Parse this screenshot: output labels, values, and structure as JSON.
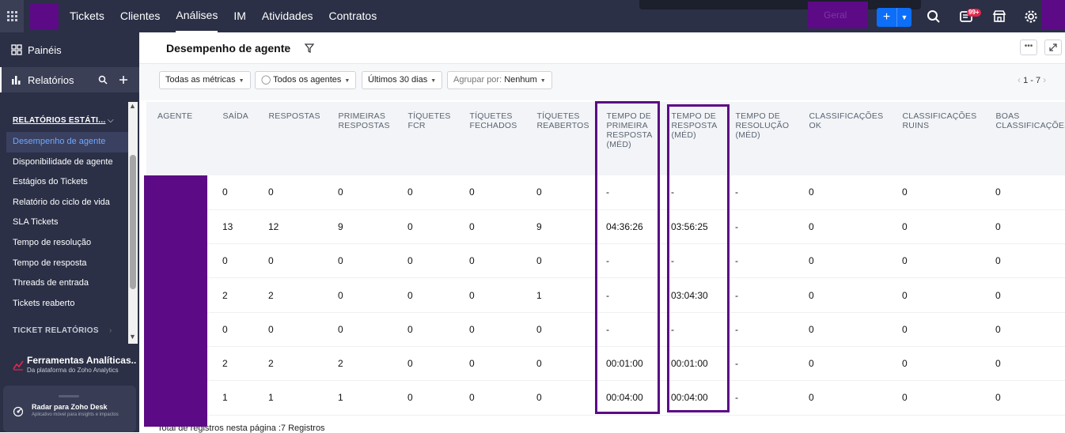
{
  "topbar": {
    "nav": [
      "Tickets",
      "Clientes",
      "Análises",
      "IM",
      "Atividades",
      "Contratos"
    ],
    "active_nav": "Análises",
    "department_label": "Geral",
    "add_label": "+",
    "notification_badge": "99+",
    "colors": {
      "bar": "#2b3046",
      "accent": "#0d6ef7",
      "redaction": "#5c0a85"
    }
  },
  "sidebar": {
    "dashboards_label": "Painéis",
    "reports_label": "Relatórios",
    "section_label": "RELATÓRIOS ESTÁTI...",
    "items": [
      "Desempenho de agente",
      "Disponibilidade de agente",
      "Estágios do Tickets",
      "Relatório do ciclo de vida",
      "SLA Tickets",
      "Tempo de resolução",
      "Tempo de resposta",
      "Threads de entrada",
      "Tickets reaberto"
    ],
    "selected_item": "Desempenho de agente",
    "section2_label": "TICKET RELATÓRIOS",
    "analytics": {
      "title": "Ferramentas Analíticas...",
      "subtitle": "Da plataforma do Zoho Analytics"
    },
    "radar": {
      "title": "Radar para Zoho Desk",
      "subtitle": "Aplicativo móvel para insights e impactos"
    }
  },
  "report": {
    "title": "Desempenho de agente",
    "filters": {
      "metrics": "Todas as métricas",
      "agents": "Todos os agentes",
      "period": "Últimos 30 dias",
      "group_by_label": "Agrupar por:",
      "group_by_value": "Nenhum"
    },
    "pagination": "1 - 7",
    "more_label": "•••",
    "columns": [
      "AGENTE",
      "SAÍDA",
      "RESPOSTAS",
      "PRIMEIRAS RESPOSTAS",
      "TÍQUETES FCR",
      "TÍQUETES FECHADOS",
      "TÍQUETES REABERTOS",
      "TEMPO DE PRIMEIRA RESPOSTA (MÉD)",
      "TEMPO DE RESPOSTA (MÉD)",
      "TEMPO DE RESOLUÇÃO (MÉD)",
      "CLASSIFICAÇÕES OK",
      "CLASSIFICAÇÕES RUINS",
      "BOAS CLASSIFICAÇÕES"
    ],
    "rows": [
      [
        "",
        "0",
        "0",
        "0",
        "0",
        "0",
        "0",
        "-",
        "-",
        "-",
        "0",
        "0",
        "0"
      ],
      [
        "",
        "13",
        "12",
        "9",
        "0",
        "0",
        "9",
        "04:36:26",
        "03:56:25",
        "-",
        "0",
        "0",
        "0"
      ],
      [
        "",
        "0",
        "0",
        "0",
        "0",
        "0",
        "0",
        "-",
        "-",
        "-",
        "0",
        "0",
        "0"
      ],
      [
        "",
        "2",
        "2",
        "0",
        "0",
        "0",
        "1",
        "-",
        "03:04:30",
        "-",
        "0",
        "0",
        "0"
      ],
      [
        "",
        "0",
        "0",
        "0",
        "0",
        "0",
        "0",
        "-",
        "-",
        "-",
        "0",
        "0",
        "0"
      ],
      [
        "",
        "2",
        "2",
        "2",
        "0",
        "0",
        "0",
        "00:01:00",
        "00:01:00",
        "-",
        "0",
        "0",
        "0"
      ],
      [
        "",
        "1",
        "1",
        "1",
        "0",
        "0",
        "0",
        "00:04:00",
        "00:04:00",
        "-",
        "0",
        "0",
        "0"
      ]
    ],
    "footer": "Total de registros nesta página :7 Registros"
  }
}
